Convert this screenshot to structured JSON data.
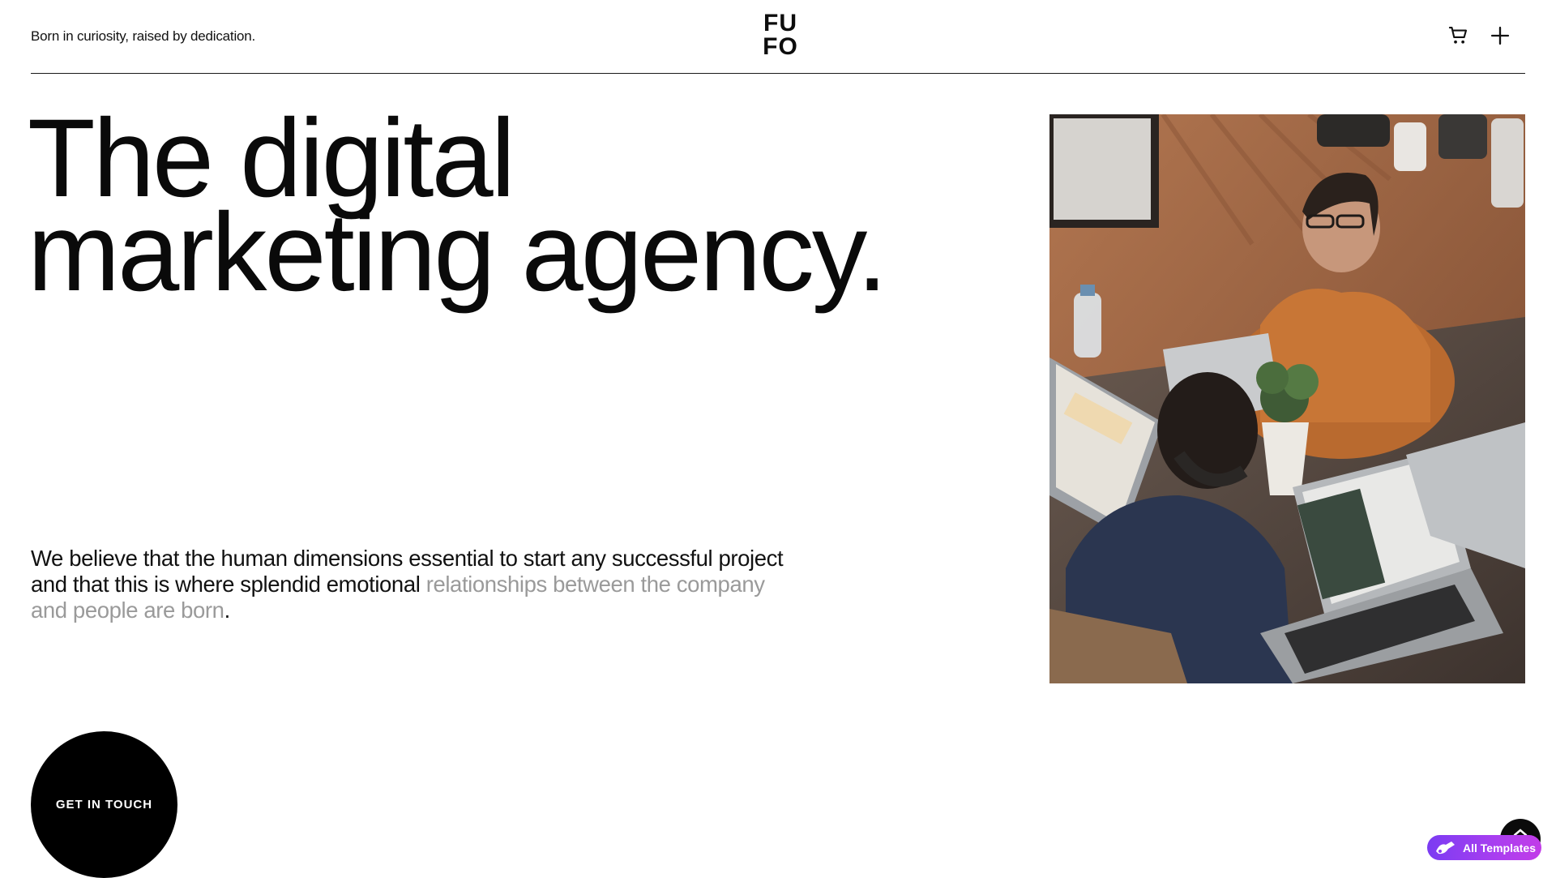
{
  "header": {
    "tagline": "Born in curiosity, raised by dedication.",
    "logo": {
      "line1": "FU",
      "line2": "FO"
    },
    "icons": [
      "cart-icon",
      "plus-icon"
    ]
  },
  "hero": {
    "headline": [
      "The digital",
      "marketing agency."
    ],
    "intro": {
      "dark": "We believe that the human dimensions essential to start any successful project and that this is where splendid emotional",
      "muted": "relationships between the company and people are born",
      "end": "."
    },
    "image": "photo-team-working-on-laptops",
    "cta_label": "GET IN TOUCH"
  },
  "floating": {
    "templates_label": "All Templates",
    "templates_icon": "elementor-logo-icon",
    "scroll_icon": "chevron-up-icon",
    "accent": "#8b3cf0"
  }
}
